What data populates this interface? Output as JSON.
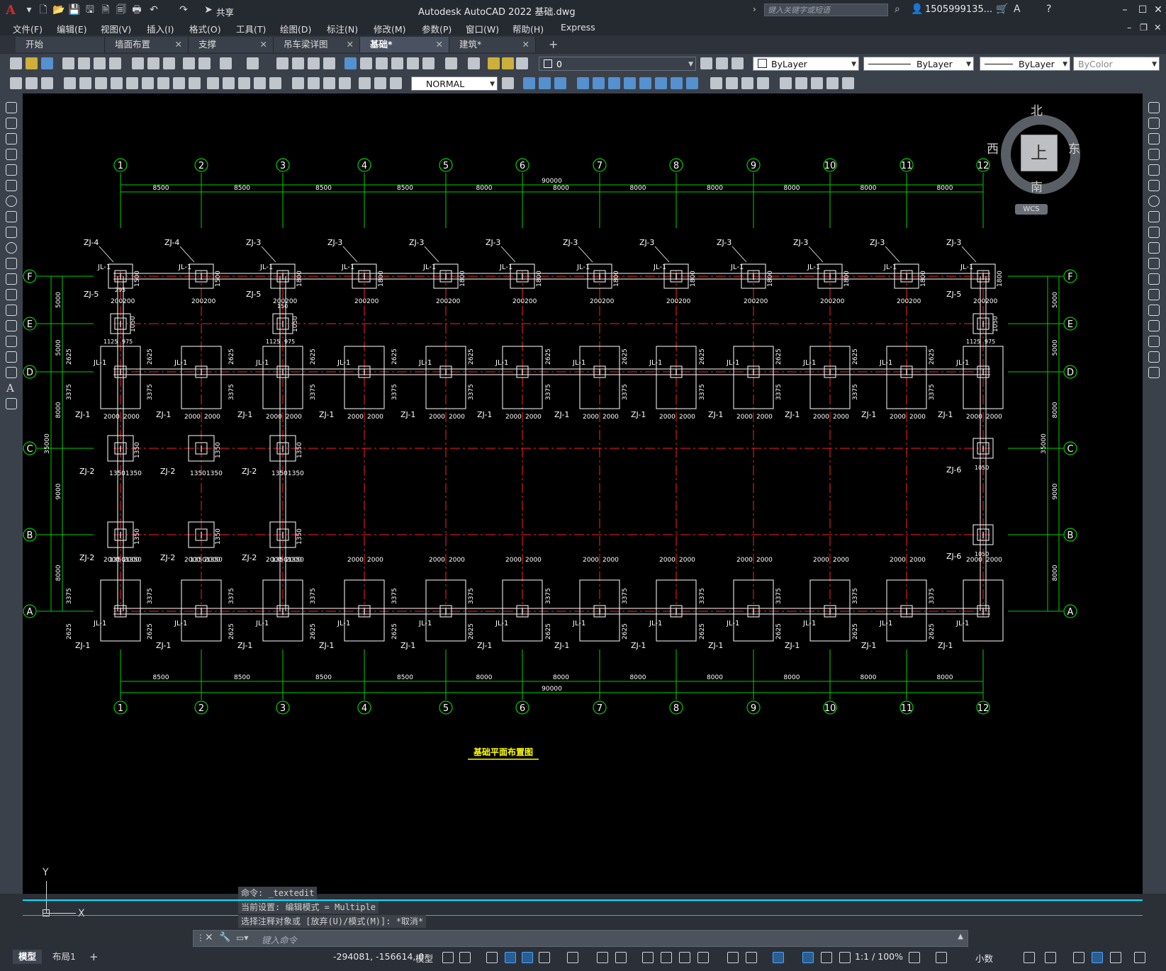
{
  "app": {
    "title": "Autodesk AutoCAD 2022    基础.dwg",
    "share_label": "共享",
    "search_placeholder": "键入关键字或短语",
    "user": "1505999135...",
    "logo": "A"
  },
  "menu": [
    "文件(F)",
    "编辑(E)",
    "视图(V)",
    "插入(I)",
    "格式(O)",
    "工具(T)",
    "绘图(D)",
    "标注(N)",
    "修改(M)",
    "参数(P)",
    "窗口(W)",
    "帮助(H)",
    "Express"
  ],
  "tabs": [
    {
      "label": "开始",
      "closable": false
    },
    {
      "label": "墙面布置",
      "closable": true
    },
    {
      "label": "支撑",
      "closable": true
    },
    {
      "label": "吊车梁详图",
      "closable": true
    },
    {
      "label": "基础*",
      "closable": true,
      "active": true
    },
    {
      "label": "建筑*",
      "closable": true
    }
  ],
  "toolbar": {
    "layer_value": "0",
    "color_value": "ByLayer",
    "linetype_value": "ByLayer",
    "lineweight_value": "ByLayer",
    "plotstyle_value": "ByColor",
    "dimstyle_value": "NORMAL"
  },
  "viewcube": {
    "north": "北",
    "south": "南",
    "east": "东",
    "west": "西",
    "top": "上",
    "wcs": "WCS"
  },
  "drawing": {
    "title": "基础平面布置图",
    "column_axes": [
      "1",
      "2",
      "3",
      "4",
      "5",
      "6",
      "7",
      "8",
      "9",
      "10",
      "11",
      "12"
    ],
    "row_axes": [
      "F",
      "E",
      "D",
      "C",
      "B",
      "A"
    ],
    "top_spacings": [
      "8500",
      "8500",
      "8500",
      "8500",
      "8000",
      "8000",
      "8000",
      "8000",
      "8000",
      "8000",
      "8000"
    ],
    "total_length": "90000",
    "total_width": "35000",
    "row_spacings": [
      "5000",
      "5000",
      "8000",
      "9000",
      "8000"
    ],
    "foundation_labels": {
      "zj1": "ZJ-1",
      "zj2": "ZJ-2",
      "zj3": "ZJ-3",
      "zj4": "ZJ-4",
      "zj5": "ZJ-5",
      "zj6": "ZJ-6",
      "jl1": "JL-1"
    },
    "dims": {
      "d2000": "2000",
      "d3375": "3375",
      "d2625": "2625",
      "d1350": "1350",
      "d1050": "1050",
      "d1800": "1800",
      "d1500": "1500",
      "d200": "200",
      "d295": "295",
      "d150": "150",
      "d975": "975",
      "d1125": "1125"
    },
    "colors": {
      "grid": "#00d000",
      "axis_red": "#ff2020",
      "outline": "#ffffff",
      "title": "#ffff00"
    }
  },
  "command": {
    "history": [
      "命令: _textedit",
      "当前设置: 编辑模式 = Multiple",
      "选择注释对象或 [放弃(U)/模式(M)]: *取消*"
    ],
    "placeholder": "键入命令"
  },
  "ucs": {
    "x": "X",
    "y": "Y"
  },
  "status": {
    "layout_tabs": [
      "模型",
      "布局1"
    ],
    "coords": "-294081, -156614, 0",
    "model_label": "模型",
    "scale": "1:1 / 100%",
    "units": "小数"
  }
}
